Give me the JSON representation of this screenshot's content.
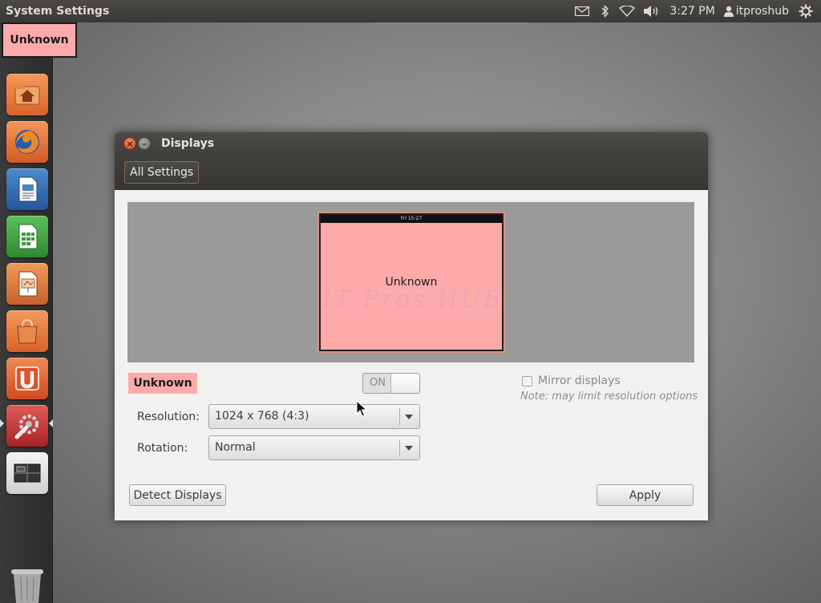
{
  "panel": {
    "app_title": "System Settings",
    "clock": "3:27 PM",
    "user": "itproshub",
    "indicators": [
      "mail-icon",
      "bluetooth-icon",
      "wifi-icon",
      "volume-icon",
      "user-icon",
      "gear-icon"
    ]
  },
  "launcher": {
    "tooltip": "Unknown",
    "items": [
      {
        "name": "home-folder",
        "icon": "folder-home-icon",
        "color": "#e8763a"
      },
      {
        "name": "firefox",
        "icon": "firefox-icon",
        "color": "#e4652a"
      },
      {
        "name": "writer",
        "icon": "writer-icon",
        "color": "#2f6db5"
      },
      {
        "name": "calc",
        "icon": "calc-icon",
        "color": "#3a9b3a"
      },
      {
        "name": "impress",
        "icon": "impress-icon",
        "color": "#d87634"
      },
      {
        "name": "software-center",
        "icon": "shopping-bag-icon",
        "color": "#e5753a"
      },
      {
        "name": "ubuntu-one",
        "icon": "ubuntu-one-icon",
        "color": "#e0552a"
      },
      {
        "name": "system-settings",
        "icon": "settings-wrench-icon",
        "color": "#c33a3a"
      },
      {
        "name": "workspace-switcher",
        "icon": "workspaces-icon",
        "color": "#e8e8e8"
      }
    ],
    "trash_icon": "trash-icon"
  },
  "window": {
    "title": "Displays",
    "all_settings_label": "All Settings",
    "preview": {
      "monitor_clock": "Fri 15:27",
      "monitor_label": "Unknown",
      "watermark": "IT Pros HUB"
    },
    "display_name": "Unknown",
    "toggle_label": "ON",
    "resolution_label": "Resolution:",
    "resolution_value": "1024 x 768 (4:3)",
    "rotation_label": "Rotation:",
    "rotation_value": "Normal",
    "mirror_label": "Mirror displays",
    "mirror_note": "Note: may limit resolution options",
    "detect_label": "Detect Displays",
    "apply_label": "Apply",
    "accent_color": "#ffaaaa"
  }
}
